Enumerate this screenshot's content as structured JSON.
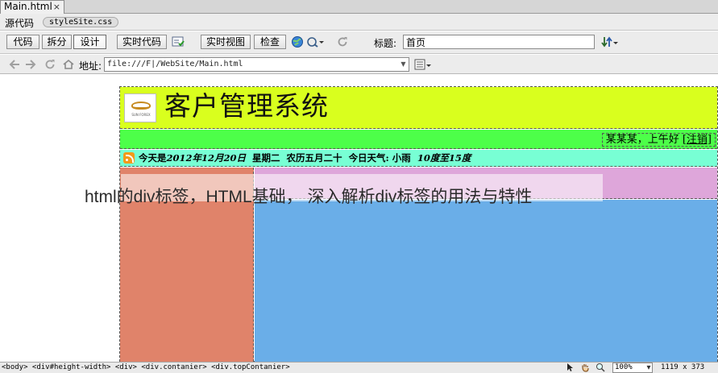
{
  "doc_tab": {
    "label": "Main.html",
    "close": "×"
  },
  "related_files": {
    "source_label": "源代码",
    "css_file": "styleSite.css"
  },
  "toolbar": {
    "code": "代码",
    "split": "拆分",
    "design": "设计",
    "live_code": "实时代码",
    "live_view": "实时视图",
    "inspect": "检查",
    "title_label": "标题:",
    "title_value": "首页"
  },
  "nav": {
    "address_label": "地址:",
    "address_value": "file:///F|/WebSite/Main.html"
  },
  "page": {
    "system_title": "客户管理系统",
    "logo_text": "SUN FOREX",
    "user_greeting": "某某某，上午好",
    "logout_link": "[注销]",
    "date_prefix": "今天是",
    "date_value": "2012年12月20日",
    "weekday": "星期二",
    "lunar": "农历五月二十",
    "weather": "今日天气: 小雨",
    "temperature": "10度至15度"
  },
  "overlay_caption": "html的div标签，HTML基础， 深入解析div标签的用法与特性",
  "status": {
    "tag_path": "<body> <div#height-width> <div> <div.contanier> <div.topContanier>",
    "zoom": "100%",
    "dimensions": "1119 x 373"
  },
  "colors": {
    "header": "#d9ff1e",
    "userbar": "#4dff49",
    "datebar": "#78ffd4",
    "left_column": "#e0836a",
    "pink_bar": "#dea6da",
    "main_column": "#6aaee8"
  }
}
